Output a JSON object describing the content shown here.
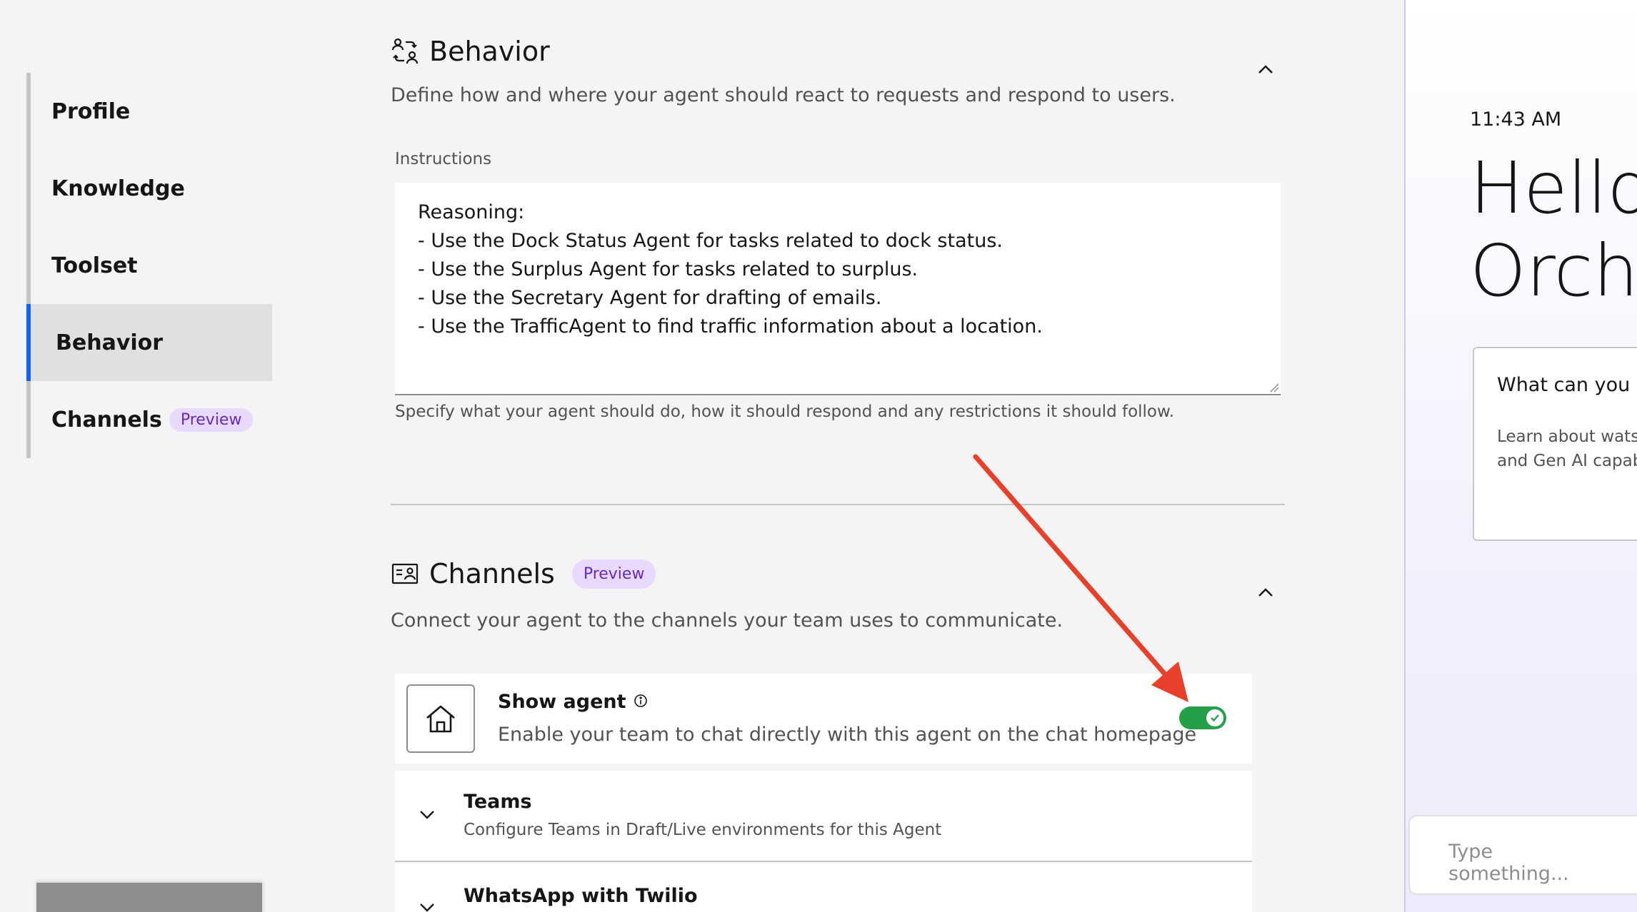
{
  "nav": {
    "items": [
      {
        "label": "Profile"
      },
      {
        "label": "Knowledge"
      },
      {
        "label": "Toolset"
      },
      {
        "label": "Behavior"
      },
      {
        "label": "Channels",
        "tag": "Preview"
      }
    ],
    "active": "Behavior"
  },
  "behavior": {
    "title": "Behavior",
    "description": "Define how and where your agent should react to requests and respond to users.",
    "instructions_label": "Instructions",
    "instructions_value": "Reasoning:\n- Use the Dock Status Agent for tasks related to dock status.\n- Use the Surplus Agent for tasks related to surplus.\n- Use the Secretary Agent for drafting of emails.\n- Use the TrafficAgent to find traffic information about a location.",
    "helper": "Specify what your agent should do, how it should respond and any restrictions it should follow."
  },
  "channels": {
    "title": "Channels",
    "tag": "Preview",
    "description": "Connect your agent to the channels your team uses to communicate.",
    "show_agent": {
      "title": "Show agent",
      "description": "Enable your team to chat directly with this agent on the chat homepage",
      "enabled": true
    },
    "teams": {
      "title": "Teams",
      "description": "Configure Teams in Draft/Live environments for this Agent"
    },
    "whatsapp": {
      "title": "WhatsApp with Twilio"
    }
  },
  "preview": {
    "time": "11:43 AM",
    "greeting": "Hello,\nOrche",
    "suggestion_title": "What can you d",
    "suggestion_desc": "Learn about watsc\nand Gen AI capab",
    "input_placeholder": "Type something..."
  },
  "colors": {
    "accent": "#0f62fe",
    "toggle_on": "#24a148",
    "tag_bg": "#e8daff",
    "tag_text": "#6929c4",
    "annotation_arrow": "#e8402a"
  },
  "icons": {
    "behavior": "behavior-icon",
    "channels": "channels-icon",
    "home": "home-icon",
    "info": "info-icon",
    "chevron_up": "chevron-up-icon",
    "chevron_down": "chevron-down-icon",
    "checkmark": "checkmark-icon"
  }
}
